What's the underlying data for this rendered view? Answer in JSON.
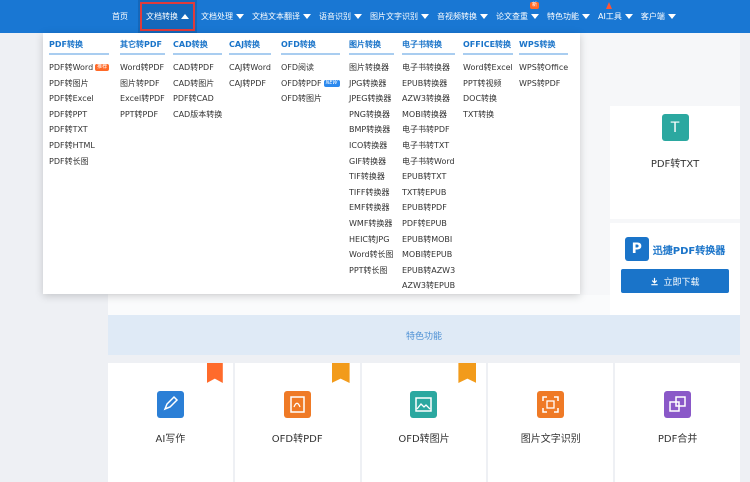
{
  "nav": {
    "items": [
      {
        "label": "首页",
        "arrow": false
      },
      {
        "label": "文档转换",
        "arrow": true,
        "active": true
      },
      {
        "label": "文档处理",
        "arrow": true
      },
      {
        "label": "文档文本翻译",
        "arrow": true
      },
      {
        "label": "语音识别",
        "arrow": true
      },
      {
        "label": "图片文字识别",
        "arrow": true
      },
      {
        "label": "音视频转换",
        "arrow": true
      },
      {
        "label": "论文查重",
        "arrow": true,
        "flag": "新"
      },
      {
        "label": "特色功能",
        "arrow": true
      },
      {
        "label": "AI工具",
        "arrow": true,
        "fire": true
      },
      {
        "label": "客户端",
        "arrow": true
      }
    ]
  },
  "dropdown": {
    "columns": [
      {
        "head": "PDF转换",
        "items": [
          {
            "label": "PDF转Word",
            "tag": "推荐"
          },
          {
            "label": "PDF转图片"
          },
          {
            "label": "PDF转Excel"
          },
          {
            "label": "PDF转PPT"
          },
          {
            "label": "PDF转TXT"
          },
          {
            "label": "PDF转HTML"
          },
          {
            "label": "PDF转长图"
          }
        ]
      },
      {
        "head": "其它转PDF",
        "items": [
          {
            "label": "Word转PDF"
          },
          {
            "label": "图片转PDF"
          },
          {
            "label": "Excel转PDF"
          },
          {
            "label": "PPT转PDF"
          }
        ]
      },
      {
        "head": "CAD转换",
        "items": [
          {
            "label": "CAD转PDF"
          },
          {
            "label": "CAD转图片"
          },
          {
            "label": "PDF转CAD"
          },
          {
            "label": "CAD版本转换"
          }
        ]
      },
      {
        "head": "CAJ转换",
        "items": [
          {
            "label": "CAJ转Word"
          },
          {
            "label": "CAJ转PDF"
          }
        ]
      },
      {
        "head": "OFD转换",
        "items": [
          {
            "label": "OFD阅读"
          },
          {
            "label": "OFD转PDF",
            "tag": "NEW"
          },
          {
            "label": "OFD转图片"
          }
        ]
      },
      {
        "head": "图片转换",
        "items": [
          {
            "label": "图片转换器"
          },
          {
            "label": "JPG转换器"
          },
          {
            "label": "JPEG转换器"
          },
          {
            "label": "PNG转换器"
          },
          {
            "label": "BMP转换器"
          },
          {
            "label": "ICO转换器"
          },
          {
            "label": "GIF转换器"
          },
          {
            "label": "TIF转换器"
          },
          {
            "label": "TIFF转换器"
          },
          {
            "label": "EMF转换器"
          },
          {
            "label": "WMF转换器"
          },
          {
            "label": "HEIC转JPG"
          },
          {
            "label": "Word转长图"
          },
          {
            "label": "PPT转长图"
          }
        ]
      },
      {
        "head": "电子书转换",
        "items": [
          {
            "label": "电子书转换器"
          },
          {
            "label": "EPUB转换器"
          },
          {
            "label": "AZW3转换器"
          },
          {
            "label": "MOBI转换器"
          },
          {
            "label": "电子书转PDF"
          },
          {
            "label": "电子书转TXT"
          },
          {
            "label": "电子书转Word"
          },
          {
            "label": "EPUB转TXT"
          },
          {
            "label": "TXT转EPUB"
          },
          {
            "label": "EPUB转PDF"
          },
          {
            "label": "PDF转EPUB"
          },
          {
            "label": "EPUB转MOBI"
          },
          {
            "label": "MOBI转EPUB"
          },
          {
            "label": "EPUB转AZW3"
          },
          {
            "label": "AZW3转EPUB"
          }
        ]
      },
      {
        "head": "OFFICE转换",
        "items": [
          {
            "label": "Word转Excel"
          },
          {
            "label": "PPT转视频"
          },
          {
            "label": "DOC转换"
          },
          {
            "label": "TXT转换"
          }
        ]
      },
      {
        "head": "WPS转换",
        "items": [
          {
            "label": "WPS转Office"
          },
          {
            "label": "WPS转PDF"
          }
        ]
      }
    ]
  },
  "side": {
    "pdf_txt_label": "PDF转TXT",
    "pdf_txt_icon_char": "T",
    "ad_logo_char": "P",
    "ad_title": "迅捷PDF转换器",
    "download_label": "立即下载"
  },
  "features": {
    "title": "特色功能",
    "cards": [
      {
        "label": "AI写作",
        "badge": "hot",
        "color": "#2b7fd6",
        "icon": "pen-icon"
      },
      {
        "label": "OFD转PDF",
        "badge": "new",
        "color": "#ef7a26",
        "icon": "pdf-icon"
      },
      {
        "label": "OFD转图片",
        "badge": "new",
        "color": "#2ba8a0",
        "icon": "image-icon"
      },
      {
        "label": "图片文字识别",
        "badge": "",
        "color": "#ef7a26",
        "icon": "ocr-icon"
      },
      {
        "label": "PDF合并",
        "badge": "",
        "color": "#8a58c8",
        "icon": "merge-icon"
      }
    ]
  }
}
